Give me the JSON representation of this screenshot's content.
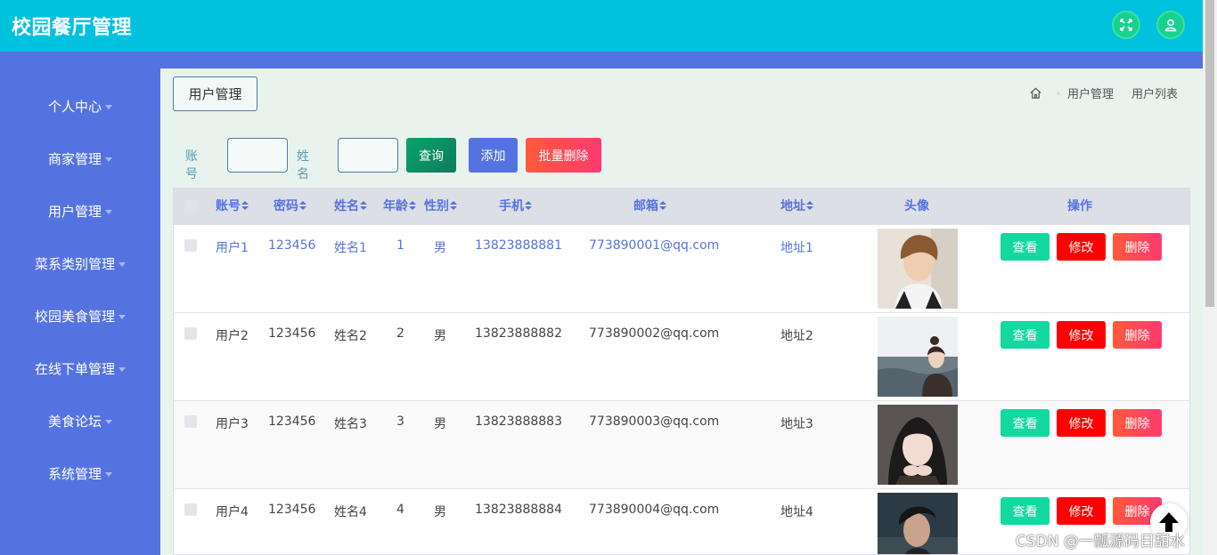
{
  "app": {
    "title": "校园餐厅管理"
  },
  "header": {
    "fullscreen_icon": "expand-icon",
    "user_icon": "user-icon"
  },
  "sidebar": {
    "items": [
      {
        "label": "个人中心"
      },
      {
        "label": "商家管理"
      },
      {
        "label": "用户管理"
      },
      {
        "label": "菜系类别管理"
      },
      {
        "label": "校园美食管理"
      },
      {
        "label": "在线下单管理"
      },
      {
        "label": "美食论坛"
      },
      {
        "label": "系统管理"
      }
    ]
  },
  "page": {
    "tag": "用户管理"
  },
  "breadcrumb": {
    "items": [
      "用户管理",
      "用户列表"
    ]
  },
  "search": {
    "account_label": "账号",
    "name_label": "姓名",
    "account_value": "",
    "name_value": "",
    "query_button": "查询",
    "add_button": "添加",
    "batch_delete_button": "批量删除"
  },
  "table": {
    "headers": {
      "account": "账号",
      "password": "密码",
      "name": "姓名",
      "age": "年龄",
      "gender": "性别",
      "phone": "手机",
      "email": "邮箱",
      "address": "地址",
      "avatar": "头像",
      "actions": "操作"
    },
    "rows": [
      {
        "account": "用户1",
        "password": "123456",
        "name": "姓名1",
        "age": "1",
        "gender": "男",
        "phone": "13823888881",
        "email": "773890001@qq.com",
        "address": "地址1"
      },
      {
        "account": "用户2",
        "password": "123456",
        "name": "姓名2",
        "age": "2",
        "gender": "男",
        "phone": "13823888882",
        "email": "773890002@qq.com",
        "address": "地址2"
      },
      {
        "account": "用户3",
        "password": "123456",
        "name": "姓名3",
        "age": "3",
        "gender": "男",
        "phone": "13823888883",
        "email": "773890003@qq.com",
        "address": "地址3"
      },
      {
        "account": "用户4",
        "password": "123456",
        "name": "姓名4",
        "age": "4",
        "gender": "男",
        "phone": "13823888884",
        "email": "773890004@qq.com",
        "address": "地址4"
      }
    ],
    "row_actions": {
      "view": "查看",
      "edit": "修改",
      "delete": "删除"
    }
  },
  "watermark": "CSDN @一瓢源码日甜水",
  "colors": {
    "header": "#00c1de",
    "sidebar": "#5573e0",
    "main_bg": "#e8f3ee",
    "view": "#13d8a0",
    "edit": "#ff0000",
    "delete": "#ff4a55"
  }
}
